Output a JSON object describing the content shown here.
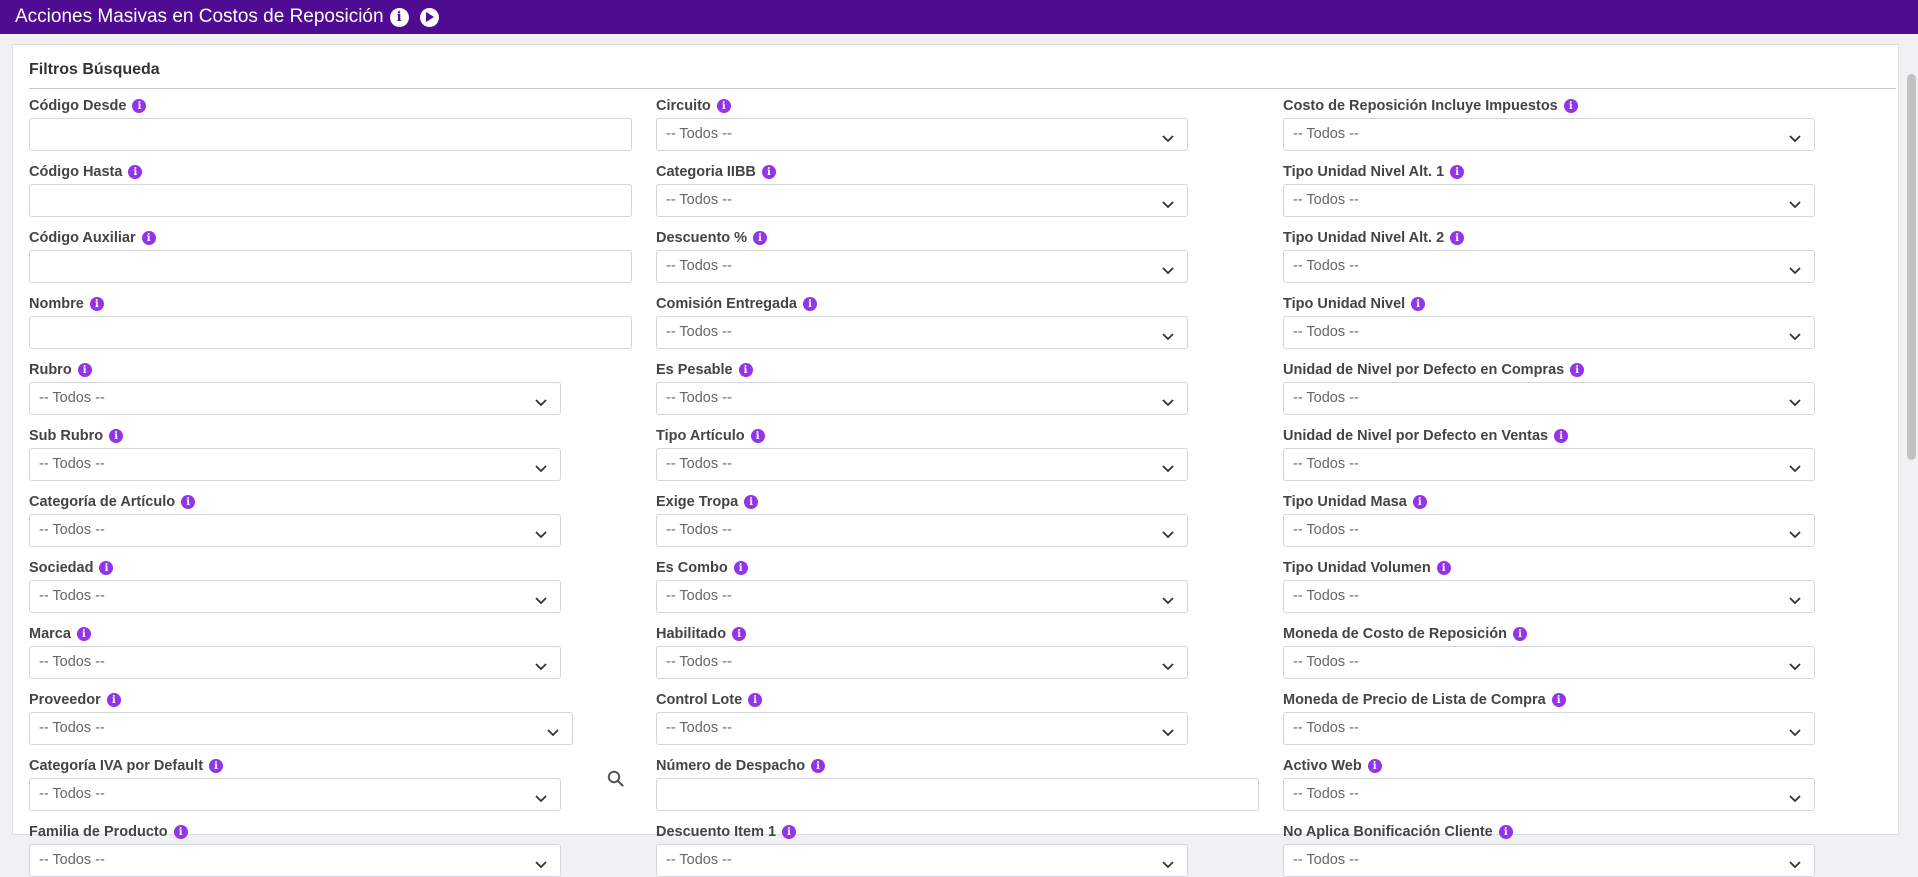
{
  "header": {
    "title": "Acciones Masivas en Costos de Reposición",
    "info_icon": "info-icon",
    "play_icon": "play-icon"
  },
  "colors": {
    "header_bg": "#4f0b91",
    "info_icon": "#9333ea"
  },
  "section": {
    "title": "Filtros Búsqueda"
  },
  "columns": [
    [
      {
        "label": "Código Desde",
        "type": "input",
        "value": ""
      },
      {
        "label": "Código Hasta",
        "type": "input",
        "value": ""
      },
      {
        "label": "Código Auxiliar",
        "type": "input",
        "value": ""
      },
      {
        "label": "Nombre",
        "type": "input",
        "value": ""
      },
      {
        "label": "Rubro",
        "type": "select",
        "value": "-- Todos --"
      },
      {
        "label": "Sub Rubro",
        "type": "select",
        "value": "-- Todos --"
      },
      {
        "label": "Categoría de Artículo",
        "type": "select",
        "value": "-- Todos --"
      },
      {
        "label": "Sociedad",
        "type": "select",
        "value": "-- Todos --"
      },
      {
        "label": "Marca",
        "type": "select",
        "value": "-- Todos --"
      },
      {
        "label": "Proveedor",
        "type": "select",
        "value": "-- Todos --"
      },
      {
        "label": "Categoría IVA por Default",
        "type": "select",
        "value": "-- Todos --"
      },
      {
        "label": "Familia de Producto",
        "type": "select",
        "value": "-- Todos --"
      }
    ],
    [
      {
        "label": "Circuito",
        "type": "select",
        "value": "-- Todos --"
      },
      {
        "label": "Categoria IIBB",
        "type": "select",
        "value": "-- Todos --"
      },
      {
        "label": "Descuento %",
        "type": "select",
        "value": "-- Todos --"
      },
      {
        "label": "Comisión Entregada",
        "type": "select",
        "value": "-- Todos --"
      },
      {
        "label": "Es Pesable",
        "type": "select",
        "value": "-- Todos --"
      },
      {
        "label": "Tipo Artículo",
        "type": "select",
        "value": "-- Todos --"
      },
      {
        "label": "Exige Tropa",
        "type": "select",
        "value": "-- Todos --"
      },
      {
        "label": "Es Combo",
        "type": "select",
        "value": "-- Todos --"
      },
      {
        "label": "Habilitado",
        "type": "select",
        "value": "-- Todos --"
      },
      {
        "label": "Control Lote",
        "type": "select",
        "value": "-- Todos --"
      },
      {
        "label": "Número de Despacho",
        "type": "input",
        "value": ""
      },
      {
        "label": "Descuento Item 1",
        "type": "select",
        "value": "-- Todos --"
      }
    ],
    [
      {
        "label": "Costo de Reposición Incluye Impuestos",
        "type": "select",
        "value": "-- Todos --"
      },
      {
        "label": "Tipo Unidad Nivel Alt. 1",
        "type": "select",
        "value": "-- Todos --"
      },
      {
        "label": "Tipo Unidad Nivel Alt. 2",
        "type": "select",
        "value": "-- Todos --"
      },
      {
        "label": "Tipo Unidad Nivel",
        "type": "select",
        "value": "-- Todos --"
      },
      {
        "label": "Unidad de Nivel por Defecto en Compras",
        "type": "select",
        "value": "-- Todos --"
      },
      {
        "label": "Unidad de Nivel por Defecto en Ventas",
        "type": "select",
        "value": "-- Todos --"
      },
      {
        "label": "Tipo Unidad Masa",
        "type": "select",
        "value": "-- Todos --"
      },
      {
        "label": "Tipo Unidad Volumen",
        "type": "select",
        "value": "-- Todos --"
      },
      {
        "label": "Moneda de Costo de Reposición",
        "type": "select",
        "value": "-- Todos --"
      },
      {
        "label": "Moneda de Precio de Lista de Compra",
        "type": "select",
        "value": "-- Todos --"
      },
      {
        "label": "Activo Web",
        "type": "select",
        "value": "-- Todos --"
      },
      {
        "label": "No Aplica Bonificación Cliente",
        "type": "select",
        "value": "-- Todos --"
      }
    ]
  ]
}
